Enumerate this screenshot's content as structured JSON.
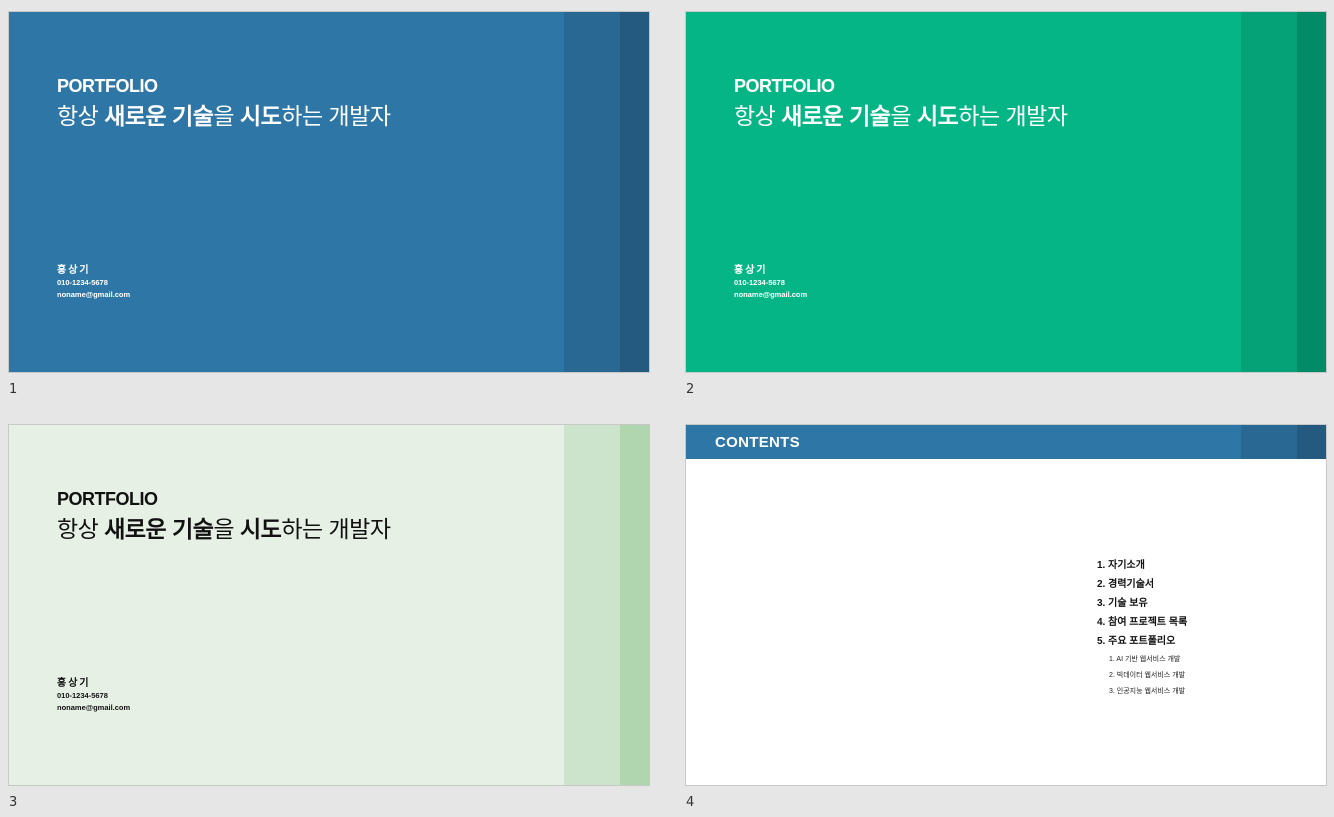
{
  "slides": [
    {
      "number": "1",
      "theme": {
        "bg": "#2e76a5",
        "stripe1": "#296893",
        "stripe2": "#245a80",
        "text": "#ffffff"
      },
      "title": "PORTFOLIO",
      "subtitle_parts": [
        "항상 ",
        "새로운 기술",
        "을 ",
        "시도",
        "하는 개발자"
      ],
      "name": "홍상기",
      "phone": "010-1234-5678",
      "email": "noname@gmail.com"
    },
    {
      "number": "2",
      "theme": {
        "bg": "#05b585",
        "stripe1": "#04a276",
        "stripe2": "#038b67",
        "text": "#ffffff"
      },
      "title": "PORTFOLIO",
      "subtitle_parts": [
        "항상 ",
        "새로운 기술",
        "을 ",
        "시도",
        "하는 개발자"
      ],
      "name": "홍상기",
      "phone": "010-1234-5678",
      "email": "noname@gmail.com"
    },
    {
      "number": "3",
      "theme": {
        "bg": "#e6f0e5",
        "stripe1": "#cce4cb",
        "stripe2": "#b0d6af",
        "text": "#111111"
      },
      "title": "PORTFOLIO",
      "subtitle_parts": [
        "항상 ",
        "새로운 기술",
        "을 ",
        "시도",
        "하는 개발자"
      ],
      "name": "홍상기",
      "phone": "010-1234-5678",
      "email": "noname@gmail.com"
    }
  ],
  "contents_slide": {
    "number": "4",
    "header": "CONTENTS",
    "theme": {
      "bar": "#2e76a5",
      "stripe1": "#296893",
      "stripe2": "#245a80",
      "bg": "#ffffff"
    },
    "items": [
      "1. 자기소개",
      "2. 경력기술서",
      "3. 기술 보유",
      "4. 참여 프로젝트 목록",
      "5. 주요 포트폴리오"
    ],
    "subitems": [
      "1.   AI 기반 웹서비스 개발",
      "2.   빅데이터 웹서비스 개발",
      "3.   인공지능 웹서비스 개발"
    ]
  }
}
